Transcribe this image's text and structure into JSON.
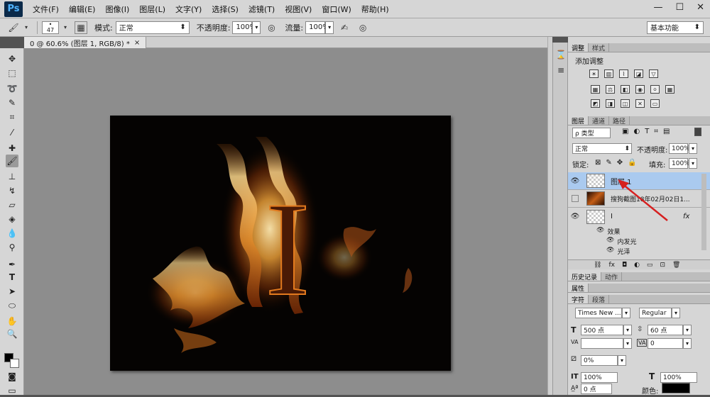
{
  "app": {
    "logo": "Ps"
  },
  "menu": [
    "文件(F)",
    "编辑(E)",
    "图像(I)",
    "图层(L)",
    "文字(Y)",
    "选择(S)",
    "滤镜(T)",
    "视图(V)",
    "窗口(W)",
    "帮助(H)"
  ],
  "window_controls": [
    "—",
    "☐",
    "✕"
  ],
  "options": {
    "brush_size": "47",
    "mode_label": "模式:",
    "mode_value": "正常",
    "opacity_label": "不透明度:",
    "opacity_value": "100%",
    "flow_label": "流量:",
    "flow_value": "100%",
    "workspace": "基本功能"
  },
  "document": {
    "tab_title": "0 @ 60.6% (图层 1, RGB/8) *",
    "close": "×",
    "letter": "I"
  },
  "panels": {
    "adjust_tabs": [
      "调整",
      "样式"
    ],
    "add_adjustment": "添加调整",
    "layers_tabs": [
      "图层",
      "通道",
      "路径"
    ],
    "filter_kind": "ρ 类型",
    "blend_mode": "正常",
    "opacity_label": "不透明度:",
    "opacity_value": "100%",
    "lock_label": "锁定:",
    "fill_label": "填充:",
    "fill_value": "100%",
    "layers": [
      {
        "name": "图层 1"
      },
      {
        "name": "搜狗截图18年02月02日1..."
      },
      {
        "name": "I",
        "fx": "fx"
      }
    ],
    "effects_label": "效果",
    "effect_items": [
      "内发光",
      "光泽"
    ],
    "history_tabs": [
      "历史记录",
      "动作"
    ],
    "properties_tab": "属性",
    "char_tabs": [
      "字符",
      "段落"
    ],
    "font_family": "Times New ...",
    "font_style": "Regular",
    "font_size": "500 点",
    "leading": "60 点",
    "kerning_va": "VA",
    "tracking": "0",
    "scale_pct": "0%",
    "vscale": "100%",
    "hscale": "100%",
    "baseline": "0 点",
    "color_label": "颜色:"
  }
}
